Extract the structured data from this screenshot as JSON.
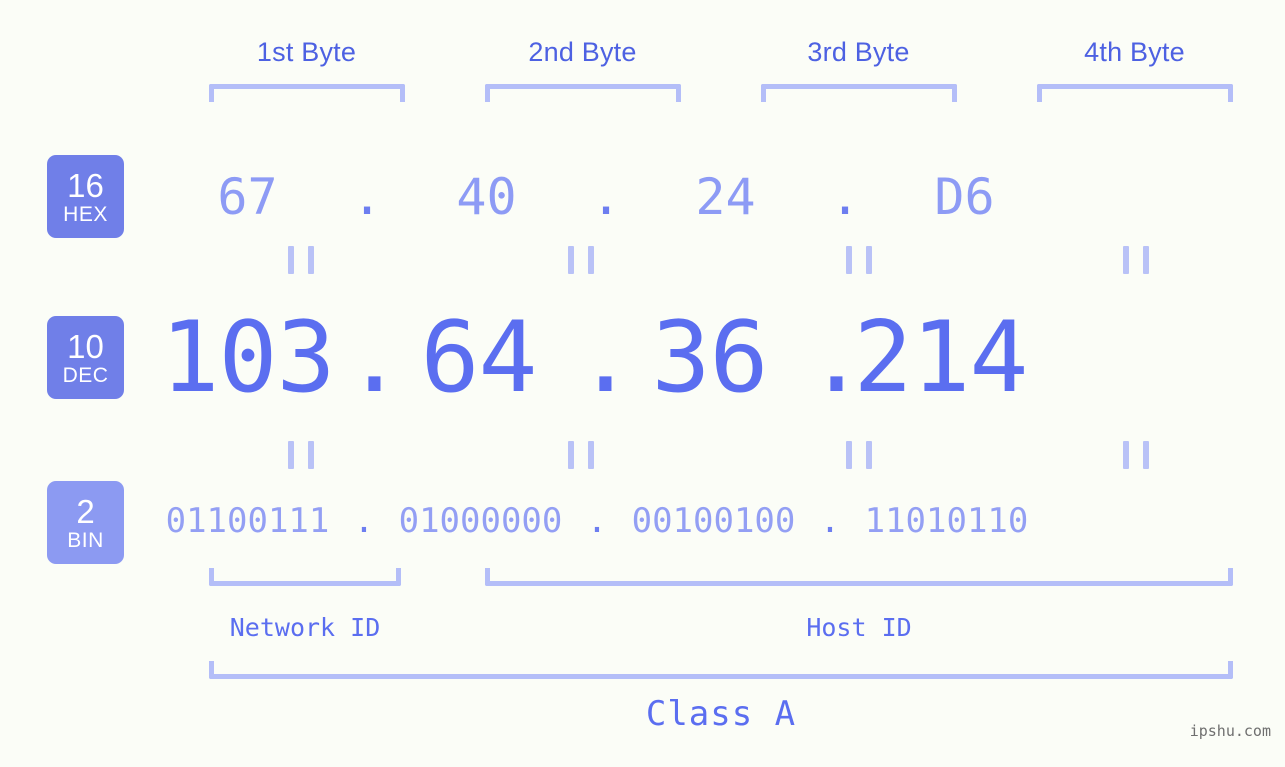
{
  "ip": {
    "dotted_decimal": "103.64.36.214",
    "class": "Class A"
  },
  "byte_headers": [
    {
      "label": "1st Byte"
    },
    {
      "label": "2nd Byte"
    },
    {
      "label": "3rd Byte"
    },
    {
      "label": "4th Byte"
    }
  ],
  "bases": {
    "hex": {
      "num": "16",
      "label": "HEX",
      "color": "#707fe8"
    },
    "dec": {
      "num": "10",
      "label": "DEC",
      "color": "#707fe8"
    },
    "bin": {
      "num": "2",
      "label": "BIN",
      "color": "#8c9af2"
    }
  },
  "rows": {
    "hex": {
      "b1": "67",
      "b2": "40",
      "b3": "24",
      "b4": "D6",
      "s1": ".",
      "s2": ".",
      "s3": "."
    },
    "dec": {
      "b1": "103",
      "b2": "64",
      "b3": "36",
      "b4": "214",
      "s1": ".",
      "s2": ".",
      "s3": "."
    },
    "bin": {
      "b1": "01100111",
      "b2": "01000000",
      "b3": "00100100",
      "b4": "11010110",
      "s1": ".",
      "s2": ".",
      "s3": "."
    }
  },
  "separators": {
    "glyph": "||"
  },
  "regions": {
    "network_id": "Network ID",
    "host_id": "Host ID",
    "class": "Class A"
  },
  "watermark": "ipshu.com",
  "colors": {
    "background": "#fbfdf7",
    "badge_strong": "#707fe8",
    "badge_light": "#8c9af2",
    "bracket": "#b4bef8",
    "text_header": "#4d61e2",
    "text_dec": "#5b6ef0",
    "text_hex": "#8d9bf5",
    "text_bin": "#939ff4"
  }
}
